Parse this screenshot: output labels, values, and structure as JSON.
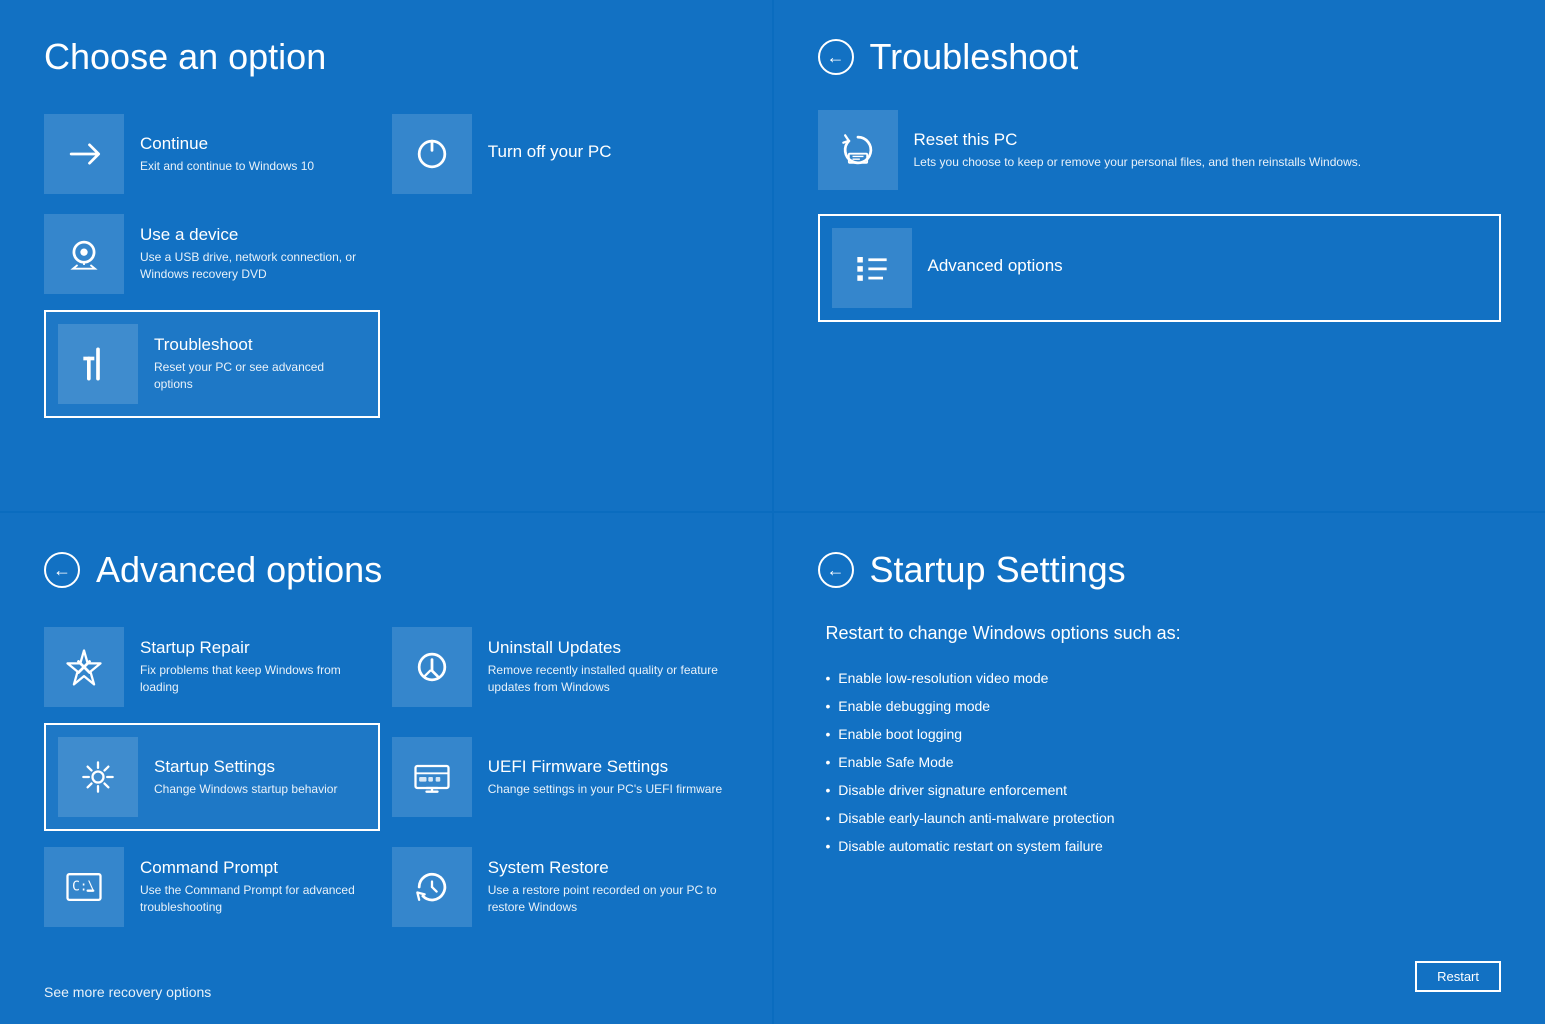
{
  "panels": {
    "choose": {
      "title": "Choose an option",
      "options": [
        {
          "id": "continue",
          "icon": "arrow",
          "label": "Continue",
          "desc": "Exit and continue to Windows 10",
          "selected": false,
          "col": "left"
        },
        {
          "id": "turn-off",
          "icon": "power",
          "label": "Turn off your PC",
          "desc": "",
          "selected": false,
          "col": "right"
        },
        {
          "id": "use-device",
          "icon": "device",
          "label": "Use a device",
          "desc": "Use a USB drive, network connection, or Windows recovery DVD",
          "selected": false,
          "col": "left"
        },
        {
          "id": "troubleshoot",
          "icon": "tools",
          "label": "Troubleshoot",
          "desc": "Reset your PC or see advanced options",
          "selected": true,
          "col": "left"
        }
      ]
    },
    "troubleshoot": {
      "title": "Troubleshoot",
      "options": [
        {
          "id": "reset-pc",
          "icon": "reset",
          "label": "Reset this PC",
          "desc": "Lets you choose to keep or remove your personal files, and then reinstalls Windows.",
          "selected": false
        },
        {
          "id": "advanced-options",
          "icon": "checklist",
          "label": "Advanced options",
          "desc": "",
          "selected": true
        }
      ]
    },
    "advanced": {
      "title": "Advanced options",
      "options": [
        {
          "id": "startup-repair",
          "icon": "repair",
          "label": "Startup Repair",
          "desc": "Fix problems that keep Windows from loading",
          "selected": false,
          "col": "left"
        },
        {
          "id": "uninstall-updates",
          "icon": "uninstall",
          "label": "Uninstall Updates",
          "desc": "Remove recently installed quality or feature updates from Windows",
          "selected": false,
          "col": "right"
        },
        {
          "id": "startup-settings",
          "icon": "gear-cog",
          "label": "Startup Settings",
          "desc": "Change Windows startup behavior",
          "selected": true,
          "col": "left"
        },
        {
          "id": "uefi",
          "icon": "uefi",
          "label": "UEFI Firmware Settings",
          "desc": "Change settings in your PC's UEFI firmware",
          "selected": false,
          "col": "right"
        },
        {
          "id": "cmd",
          "icon": "cmd",
          "label": "Command Prompt",
          "desc": "Use the Command Prompt for advanced troubleshooting",
          "selected": false,
          "col": "left"
        },
        {
          "id": "system-restore",
          "icon": "restore",
          "label": "System Restore",
          "desc": "Use a restore point recorded on your PC to restore Windows",
          "selected": false,
          "col": "right"
        }
      ],
      "see_more": "See more recovery options"
    },
    "startup": {
      "title": "Startup Settings",
      "subtitle": "Restart to change Windows options such as:",
      "list": [
        "Enable low-resolution video mode",
        "Enable debugging mode",
        "Enable boot logging",
        "Enable Safe Mode",
        "Disable driver signature enforcement",
        "Disable early-launch anti-malware protection",
        "Disable automatic restart on system failure"
      ],
      "restart_label": "Restart"
    }
  }
}
